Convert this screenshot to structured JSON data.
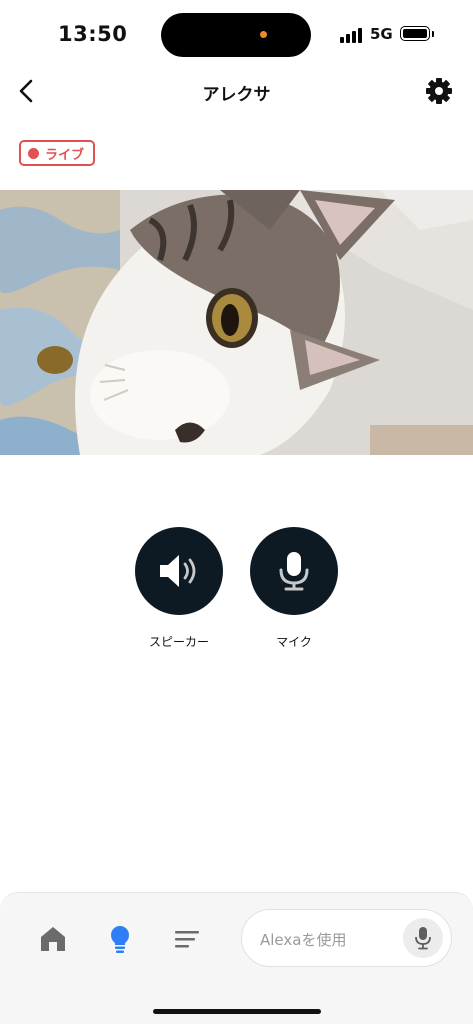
{
  "status_bar": {
    "time": "13:50",
    "network": "5G"
  },
  "nav": {
    "title": "アレクサ"
  },
  "live_badge": {
    "label": "ライブ"
  },
  "camera_feed": {
    "icon": "camera-live-image"
  },
  "controls": [
    {
      "label": "スピーカー",
      "icon": "speaker-icon"
    },
    {
      "label": "マイク",
      "icon": "microphone-icon"
    }
  ],
  "bottom_bar": {
    "tabs": [
      {
        "icon": "home-icon",
        "active": false
      },
      {
        "icon": "lightbulb-icon",
        "active": true
      },
      {
        "icon": "menu-icon",
        "active": false
      }
    ],
    "alexa_placeholder": "Alexaを使用"
  },
  "colors": {
    "live_red": "#e05252",
    "control_bg": "#0d1a24",
    "active_blue": "#2f7ef6",
    "inactive_gray": "#6b6b6b"
  }
}
